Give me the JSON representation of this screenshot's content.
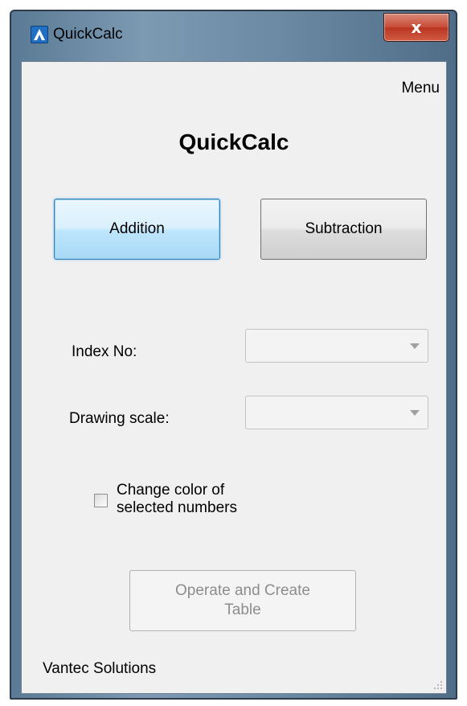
{
  "window": {
    "title": "QuickCalc",
    "close_label": "x",
    "icon": "autocad-a-icon"
  },
  "menu": {
    "label": "Menu"
  },
  "heading": "QuickCalc",
  "buttons": {
    "addition": "Addition",
    "subtraction": "Subtraction",
    "operate_line1": "Operate and Create",
    "operate_line2": "Table"
  },
  "fields": {
    "index_label": "Index No:",
    "index_value": "",
    "scale_label": "Drawing scale:",
    "scale_value": ""
  },
  "checkbox": {
    "line1": "Change color of",
    "line2": "selected numbers",
    "checked": false
  },
  "footer": "Vantec Solutions",
  "colors": {
    "accent": "#3c7fb1",
    "close_button": "#c84b36",
    "disabled_text": "#8d8d8d"
  }
}
